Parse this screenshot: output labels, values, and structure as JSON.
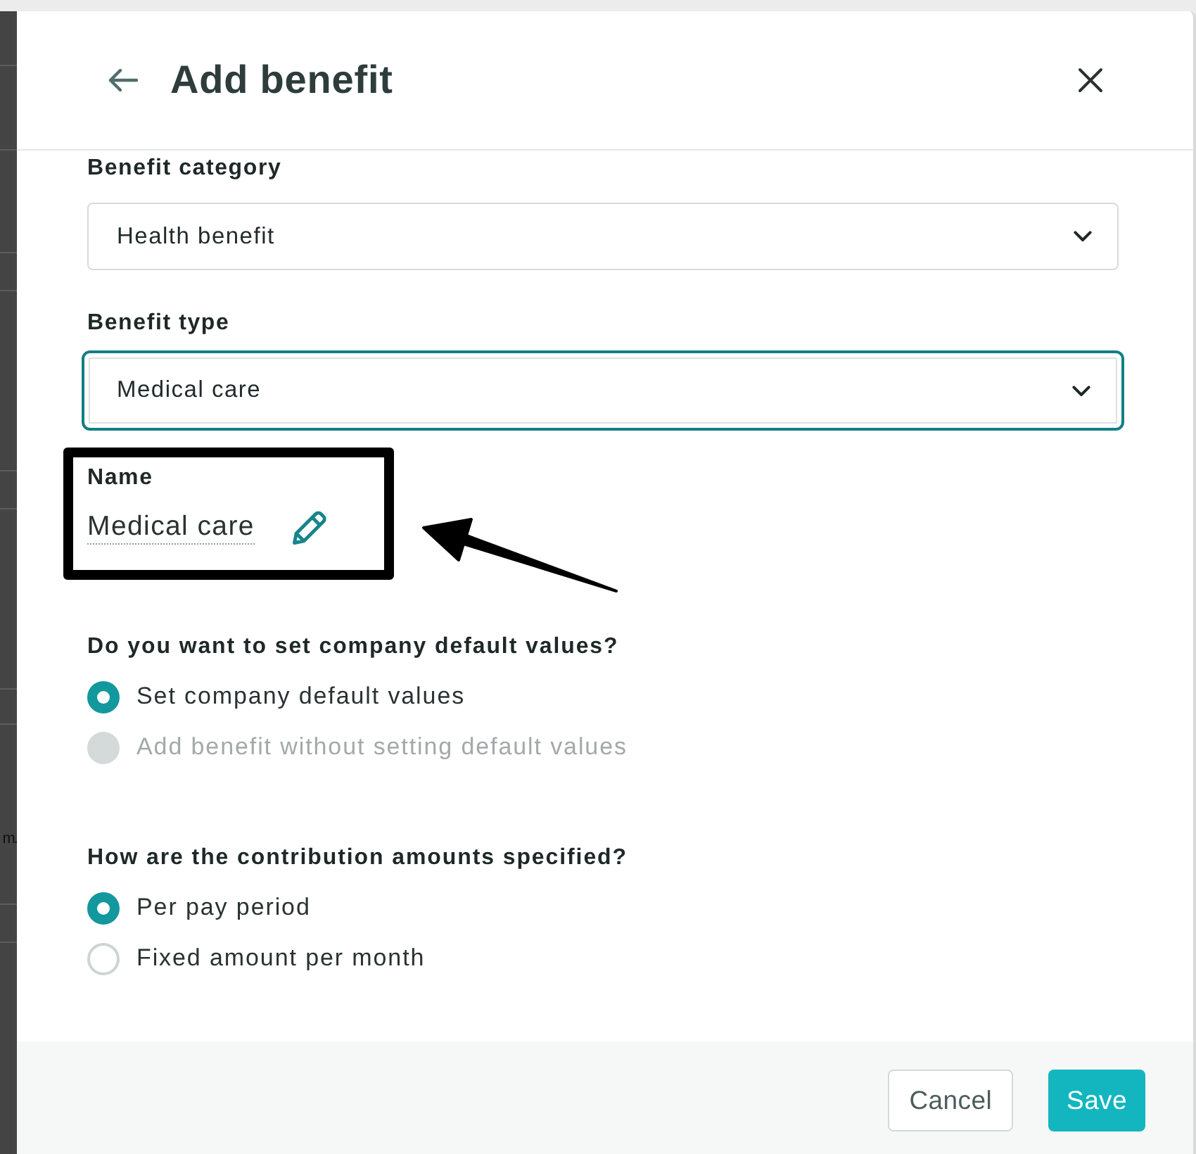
{
  "backdrop": {
    "text_fragment": "m."
  },
  "dialog": {
    "title": "Add benefit"
  },
  "fields": [
    {
      "label": "Benefit category",
      "value": "Health benefit",
      "focused": false
    },
    {
      "label": "Benefit type",
      "value": "Medical care",
      "focused": true
    }
  ],
  "name_field": {
    "label": "Name",
    "value": "Medical care"
  },
  "radio_groups": [
    {
      "question": "Do you want to set company default values?",
      "options": [
        {
          "label": "Set company default values",
          "selected": true,
          "disabled": false
        },
        {
          "label": "Add benefit without setting default values",
          "selected": false,
          "disabled": true
        }
      ]
    },
    {
      "question": "How are the contribution amounts specified?",
      "options": [
        {
          "label": "Per pay period",
          "selected": true,
          "disabled": false
        },
        {
          "label": "Fixed amount per month",
          "selected": false,
          "disabled": false
        }
      ]
    }
  ],
  "buttons": [
    {
      "label": "Cancel",
      "kind": "secondary"
    },
    {
      "label": "Save",
      "kind": "primary"
    }
  ]
}
